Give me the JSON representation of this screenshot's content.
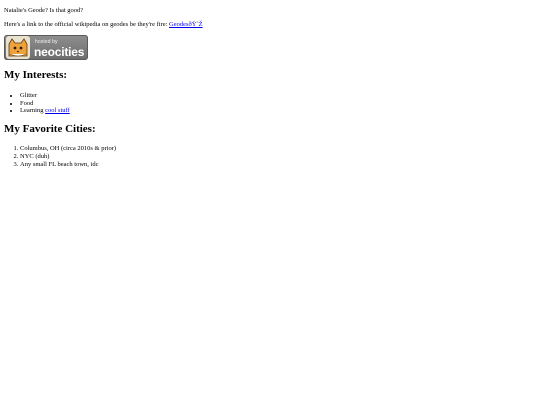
{
  "intro": {
    "text": "Natalie's Geode? Is that good?"
  },
  "link_line": {
    "prefix": "Here's a link to the official wikipedia on geodes be they're fire: ",
    "link_text": "GeodesðŸ˜Ž"
  },
  "badge": {
    "small_text": "hosted by",
    "big_text": "neocities",
    "icon": "neocities-cat-icon"
  },
  "interests": {
    "heading": "My Interests:",
    "items": [
      {
        "text": "Glitter"
      },
      {
        "text": "Food"
      },
      {
        "text": "Learning ",
        "link_text": "cool stuff"
      }
    ]
  },
  "cities": {
    "heading": "My Favorite Cities:",
    "items": [
      "Columbus, OH (circa 2010s & prior)",
      "NYC (duh)",
      "Any small FL beach town, idc"
    ]
  },
  "colors": {
    "link": "#0000ee",
    "badge_bg": "#7a7a7a",
    "cat_orange": "#f0a23a"
  }
}
